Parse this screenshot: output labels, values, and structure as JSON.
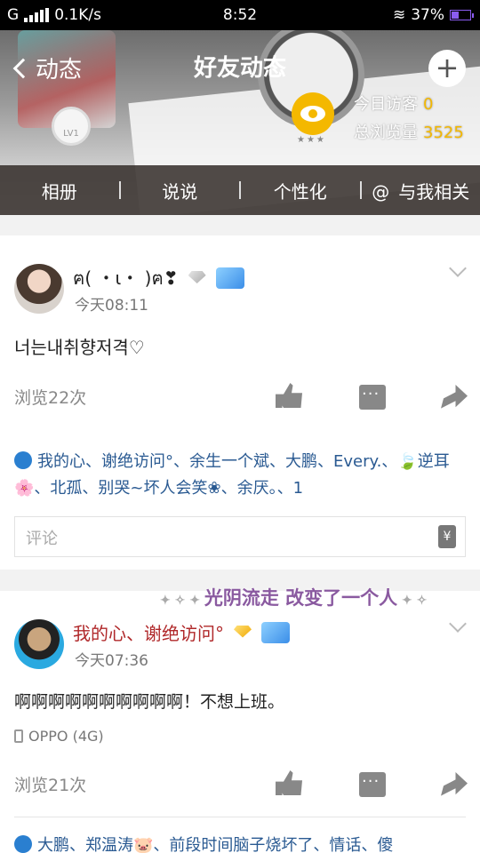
{
  "status": {
    "carrier": "G",
    "speed": "0.1K/s",
    "time": "8:52",
    "battery": "37%"
  },
  "header": {
    "back_label": "动态",
    "title": "好友动态",
    "plus": "+",
    "level": "LV1",
    "visitors_today_label": "今日访客",
    "visitors_today": "0",
    "total_views_label": "总浏览量",
    "total_views": "3525",
    "stars": "★★★",
    "tabs": [
      "相册",
      "说说",
      "个性化",
      "与我相关"
    ],
    "at_symbol": "@"
  },
  "posts": [
    {
      "name": "ฅ( ・ι・ )ฅ❣",
      "time": "今天08:11",
      "content": "너는내취향저격♡",
      "views": "浏览22次",
      "likes": "我的心、谢绝访问°、余生一个斌、大鹏、Every.、🍃逆耳🌸、北孤、别哭~坏人会笑❀、余厌。、1",
      "comment_placeholder": "评论",
      "gift_symbol": "¥"
    },
    {
      "name": "我的心、谢绝访问°",
      "time": "今天07:36",
      "content": "啊啊啊啊啊啊啊啊啊啊！不想上班。",
      "device": "OPPO (4G)",
      "views": "浏览21次",
      "likes": "大鹏、郑温涛🐷、前段时间脑子烧坏了、情话、傻",
      "banner": "光阴流走 改变了一个人"
    }
  ]
}
